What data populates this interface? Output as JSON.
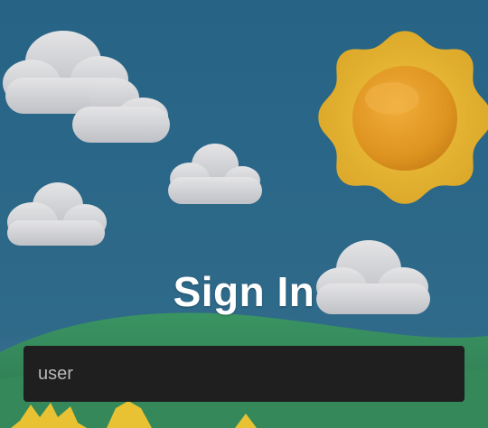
{
  "signin": {
    "title": "Sign In",
    "username_placeholder": "user",
    "username_value": ""
  },
  "colors": {
    "sky_top": "#266385",
    "sky_bottom": "#3b6f8e",
    "hill_dark": "#2f7f57",
    "hill_light": "#3e9a61",
    "sun_rays": "#e2b12b",
    "sun_core": "#e59a22",
    "cloud": "#d7d7d9",
    "field_bg": "#1f1f1f",
    "title_text": "#ffffff"
  },
  "icons": [
    "sun-icon",
    "cloud-icon"
  ]
}
